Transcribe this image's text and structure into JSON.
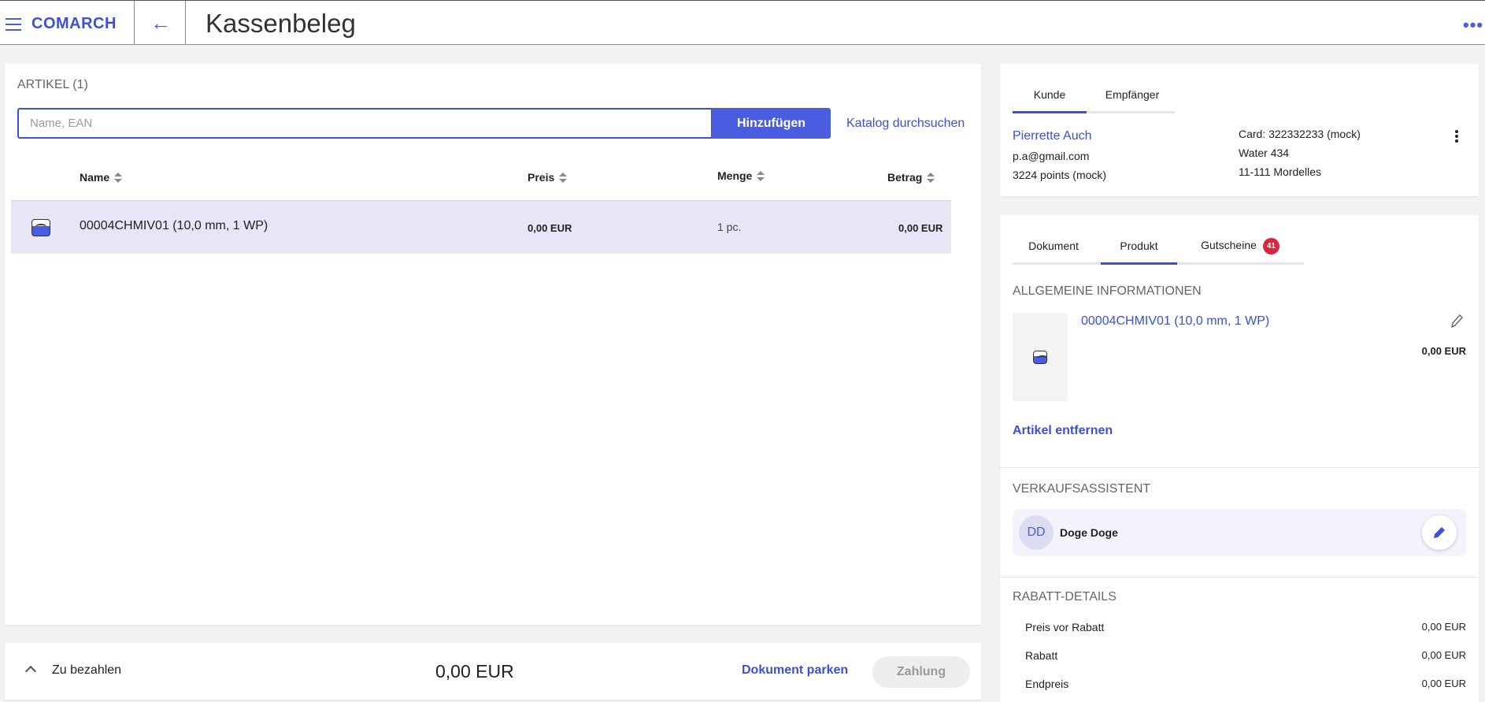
{
  "header": {
    "brand": "COMARCH",
    "title": "Kassenbeleg",
    "menu_icon": "hamburger-icon",
    "back_icon": "arrow-left-icon",
    "more_icon": "more-horizontal-icon",
    "more_glyph": "•••",
    "back_glyph": "←"
  },
  "articles": {
    "title": "ARTIKEL (1)",
    "search_placeholder": "Name, EAN",
    "search_value": "",
    "add_label": "Hinzufügen",
    "catalog_link": "Katalog durchsuchen",
    "columns": {
      "name": "Name",
      "price": "Preis",
      "qty": "Menge",
      "amount": "Betrag"
    },
    "rows": [
      {
        "name": "00004CHMIV01 (10,0 mm, 1 WP)",
        "price": "0,00 EUR",
        "qty": "1 pc.",
        "amount": "0,00 EUR",
        "icon": "image-placeholder-icon"
      }
    ]
  },
  "footer": {
    "label": "Zu bezahlen",
    "total": "0,00 EUR",
    "park_link": "Dokument parken",
    "pay_label": "Zahlung"
  },
  "customer": {
    "tabs": [
      "Kunde",
      "Empfänger"
    ],
    "active_tab": "Kunde",
    "name": "Pierrette Auch",
    "email": "p.a@gmail.com",
    "points": "3224 points (mock)",
    "card": "Card: 322332233 (mock)",
    "street": "Water 434",
    "city": "11-111 Mordelles"
  },
  "details": {
    "tabs": [
      "Dokument",
      "Produkt",
      "Gutscheine"
    ],
    "active_tab": "Produkt",
    "voucher_count": "41",
    "general_title": "ALLGEMEINE INFORMATIONEN",
    "product_name": "00004CHMIV01 (10,0 mm, 1 WP)",
    "product_price": "0,00 EUR",
    "remove_link": "Artikel entfernen",
    "assistant_title": "VERKAUFSASSISTENT",
    "assistant_initials": "DD",
    "assistant_name": "Doge Doge",
    "discount_title": "RABATT-DETAILS",
    "discount_rows": [
      {
        "label": "Preis vor Rabatt",
        "value": "0,00 EUR"
      },
      {
        "label": "Rabatt",
        "value": "0,00 EUR"
      },
      {
        "label": "Endpreis",
        "value": "0,00 EUR"
      }
    ]
  },
  "colors": {
    "accent": "#4a5ce0",
    "selected_row": "#e6e6f6",
    "badge": "#d7263d"
  }
}
